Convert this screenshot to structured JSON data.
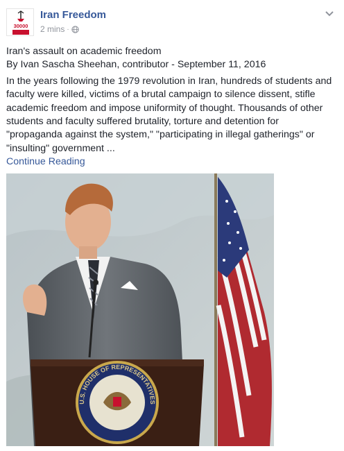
{
  "post": {
    "page_name": "Iran Freedom",
    "timestamp": "2 mins",
    "separator": "·",
    "privacy_icon": "globe-icon",
    "avatar_text": "30000",
    "menu_icon": "chevron-down-icon",
    "headline": "Iran's assault on academic freedom",
    "byline": "By Ivan Sascha Sheehan, contributor - September 11, 2016",
    "body": "In the years following the 1979 revolution in Iran, hundreds of students and faculty were killed, victims of a brutal campaign to silence dissent, stifle academic freedom and impose uniformity of thought. Thousands of other students and faculty suffered brutality, torture and detention for \"propaganda against the system,\" \"participating in illegal gatherings\" or \"insulting\" government ...",
    "continue_label": "Continue Reading",
    "image_seal_text": "U.S. HOUSE OF REPRESENTATIVES"
  },
  "colors": {
    "link": "#365899",
    "meta": "#90949c",
    "text": "#1d2129",
    "avatar_red": "#c8102e"
  }
}
